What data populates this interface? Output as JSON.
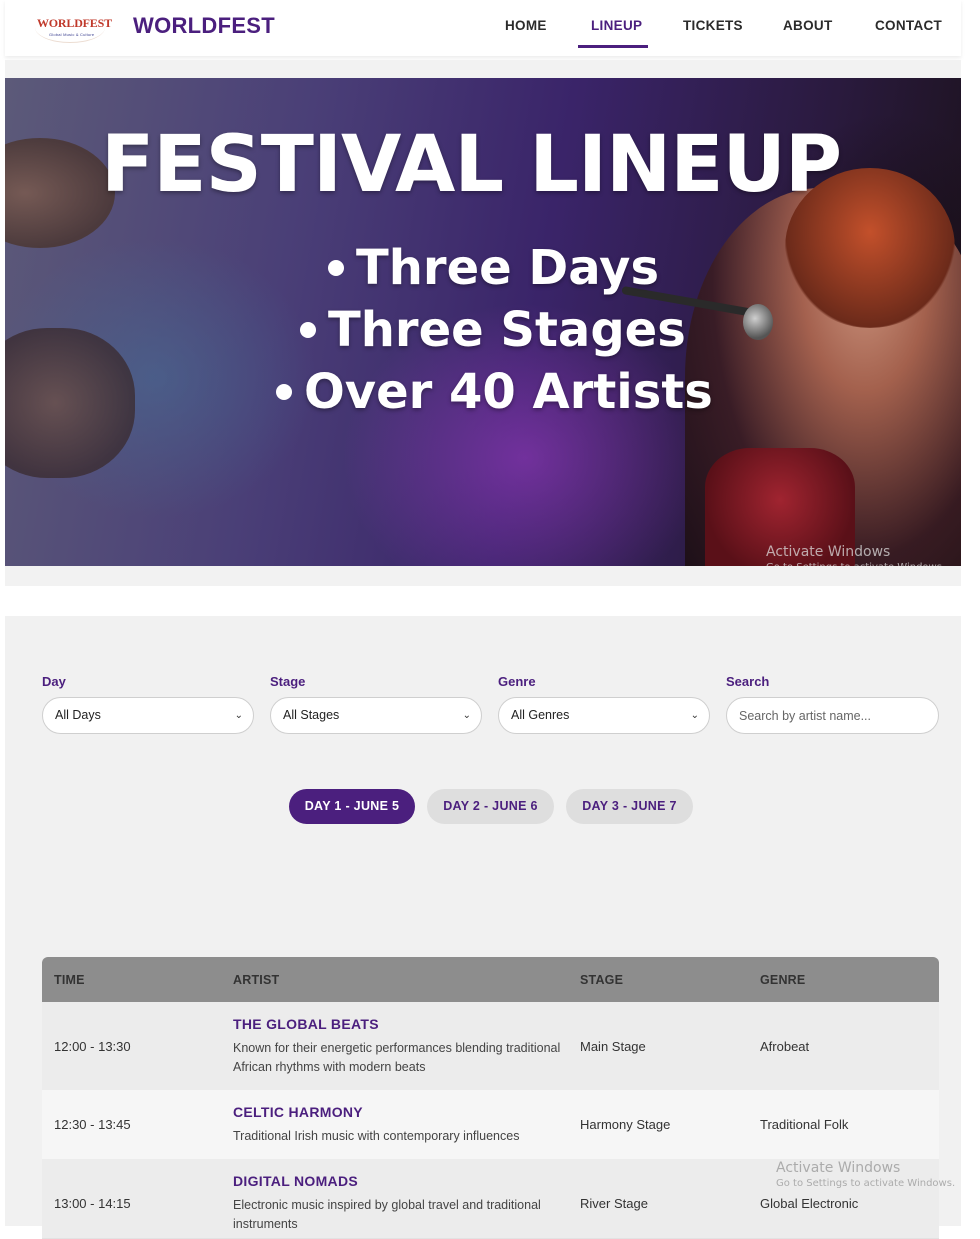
{
  "header": {
    "logo_text": "WORLDFEST",
    "logo_subtext": "Global Music & Culture",
    "brand": "WORLDFEST",
    "nav": [
      {
        "label": "HOME"
      },
      {
        "label": "LINEUP"
      },
      {
        "label": "TICKETS"
      },
      {
        "label": "ABOUT"
      },
      {
        "label": "CONTACT"
      }
    ],
    "active_nav": "LINEUP"
  },
  "hero": {
    "title": "FESTIVAL LINEUP",
    "bullets": [
      "Three Days",
      "Three Stages",
      "Over 40 Artists"
    ]
  },
  "watermark": {
    "line1": "Activate Windows",
    "line2": "Go to Settings to activate Windows."
  },
  "filters": {
    "day": {
      "label": "Day",
      "value": "All Days"
    },
    "stage": {
      "label": "Stage",
      "value": "All Stages"
    },
    "genre": {
      "label": "Genre",
      "value": "All Genres"
    },
    "search": {
      "label": "Search",
      "placeholder": "Search by artist name..."
    }
  },
  "day_tabs": [
    {
      "label": "DAY 1 - JUNE 5",
      "active": true
    },
    {
      "label": "DAY 2 - JUNE 6",
      "active": false
    },
    {
      "label": "DAY 3 - JUNE 7",
      "active": false
    }
  ],
  "table": {
    "headers": [
      "TIME",
      "ARTIST",
      "STAGE",
      "GENRE"
    ],
    "rows": [
      {
        "time": "12:00 - 13:30",
        "artist": "THE GLOBAL BEATS",
        "description": "Known for their energetic performances blending traditional African rhythms with modern beats",
        "stage": "Main Stage",
        "genre": "Afrobeat"
      },
      {
        "time": "12:30 - 13:45",
        "artist": "CELTIC HARMONY",
        "description": "Traditional Irish music with contemporary influences",
        "stage": "Harmony Stage",
        "genre": "Traditional Folk"
      },
      {
        "time": "13:00 - 14:15",
        "artist": "DIGITAL NOMADS",
        "description": "Electronic music inspired by global travel and traditional instruments",
        "stage": "River Stage",
        "genre": "Global Electronic"
      }
    ]
  },
  "colors": {
    "accent": "#4b1f7e",
    "table_header": "#8d8d8d",
    "section_bg": "#f1f1f1"
  }
}
